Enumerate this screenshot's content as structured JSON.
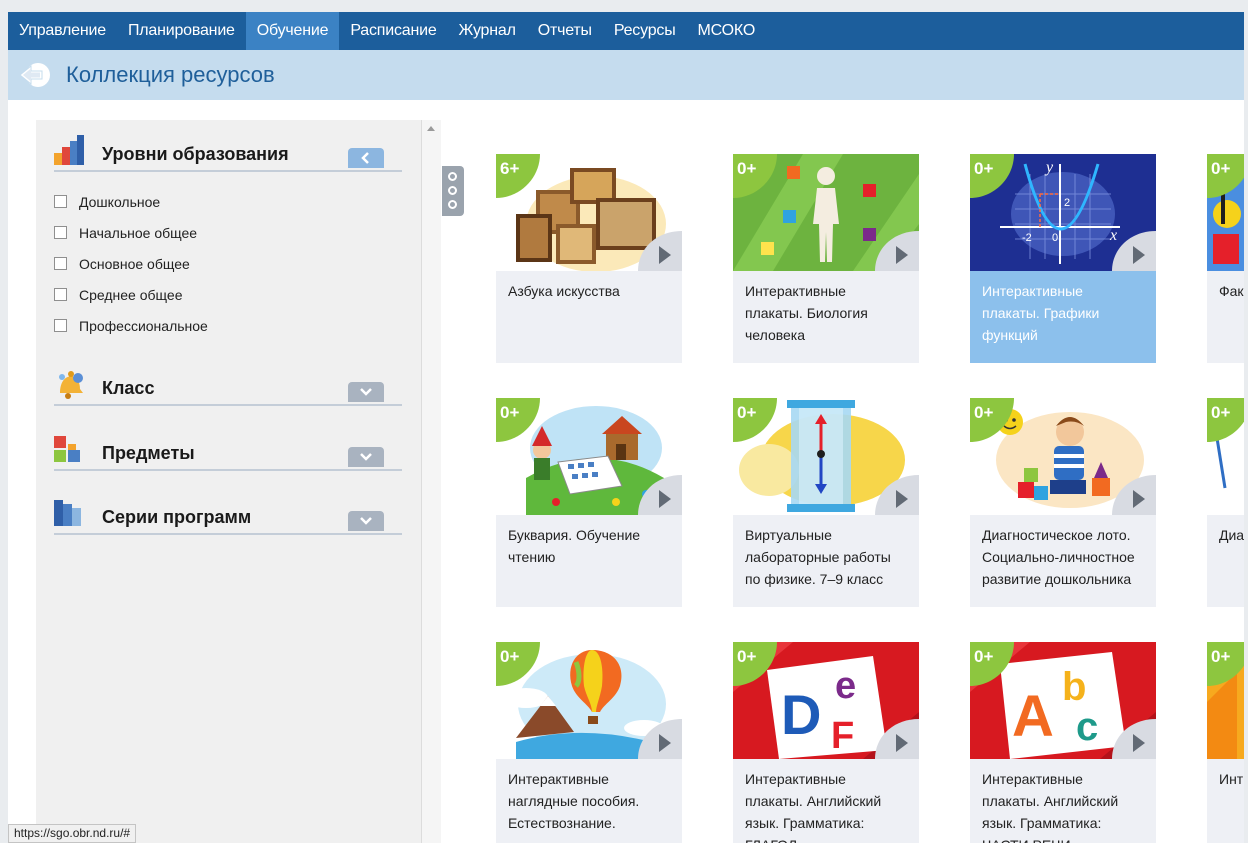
{
  "nav": {
    "items": [
      {
        "label": "Управление"
      },
      {
        "label": "Планирование"
      },
      {
        "label": "Обучение",
        "active": true
      },
      {
        "label": "Расписание"
      },
      {
        "label": "Журнал"
      },
      {
        "label": "Отчеты"
      },
      {
        "label": "Ресурсы"
      },
      {
        "label": "МСОКО"
      }
    ]
  },
  "header": {
    "title": "Коллекция ресурсов"
  },
  "filters": {
    "levels": {
      "title": "Уровни образования",
      "options": [
        "Дошкольное",
        "Начальное общее",
        "Основное общее",
        "Среднее общее",
        "Профессиональное"
      ]
    },
    "grade": {
      "title": "Класс"
    },
    "subjects": {
      "title": "Предметы"
    },
    "series": {
      "title": "Серии программ"
    }
  },
  "resources": [
    {
      "age": "6+",
      "title": "Азбука искусства"
    },
    {
      "age": "0+",
      "title": "Интерактивные плакаты. Биология человека"
    },
    {
      "age": "0+",
      "title": "Интерактивные плакаты. Графики функций",
      "highlight": true
    },
    {
      "age": "0+",
      "title": "Фак Вол кон"
    },
    {
      "age": "0+",
      "title": "Буквария. Обучение чтению"
    },
    {
      "age": "0+",
      "title": "Виртуальные лабораторные работы по физике. 7–9 класс"
    },
    {
      "age": "0+",
      "title": "Диагностическое лото. Социально-личностное развитие дошкольника"
    },
    {
      "age": "0+",
      "title": "Диа Соц раз шко"
    },
    {
      "age": "0+",
      "title": "Интерактивные наглядные пособия. Естествознание."
    },
    {
      "age": "0+",
      "title": "Интерактивные плакаты. Английский язык. Грамматика: ГЛАГОЛ"
    },
    {
      "age": "0+",
      "title": "Интерактивные плакаты. Английский язык. Грамматика: ЧАСТИ РЕЧИ"
    },
    {
      "age": "0+",
      "title": "Инт пла мат отк"
    }
  ],
  "art": {
    "letters_def": [
      "D",
      "e",
      "F"
    ],
    "letters_abc": [
      "A",
      "b",
      "c"
    ],
    "graph_labels": [
      "y",
      "x",
      "2",
      "-2",
      "0"
    ]
  },
  "colors": {
    "nav": "#1c5e9c",
    "nav_active": "#3b82c4",
    "titlebar": "#c5dcee",
    "badge": "#8dc63f",
    "highlight": "#8cc0ec"
  },
  "status": {
    "url": "https://sgo.obr.nd.ru/#"
  }
}
